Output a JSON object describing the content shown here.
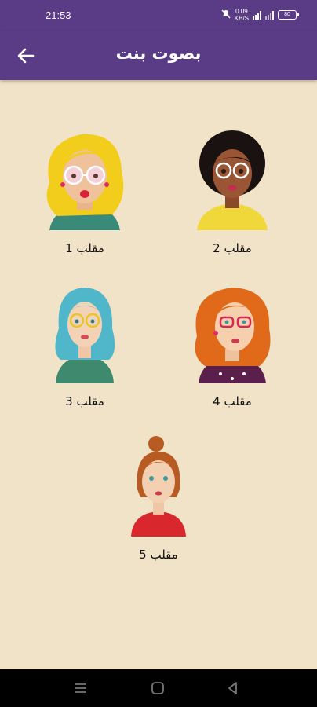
{
  "status": {
    "time": "21:53",
    "speed_value": "0.09",
    "speed_unit": "KB/S",
    "battery": "80"
  },
  "header": {
    "title": "بصوت بنت"
  },
  "pranks": [
    {
      "label": "مقلب 1",
      "hair": "#f2cd1c"
    },
    {
      "label": "مقلب 2",
      "hair": "#1a1210"
    },
    {
      "label": "مقلب 3",
      "hair": "#4fb7c9"
    },
    {
      "label": "مقلب 4",
      "hair": "#e06a1a"
    },
    {
      "label": "مقلب 5",
      "hair": "#b85b22"
    }
  ],
  "colors": {
    "primary": "#5a3b86",
    "background": "#f1e3c8"
  }
}
